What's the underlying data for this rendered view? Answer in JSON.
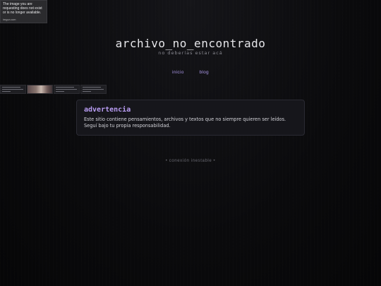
{
  "broken_image": {
    "message": "The image you are\nrequesting does not exist\nor is no longer available.",
    "footer": "imgur.com"
  },
  "header": {
    "title": "archivo_no_encontrado",
    "subtitle": "no deberías estar acá"
  },
  "nav": {
    "items": [
      {
        "label": "inicio"
      },
      {
        "label": "blog"
      }
    ]
  },
  "warning": {
    "title": "advertencia",
    "text": "Este sitio contiene pensamientos, archivos y textos que no siempre quieren ser leídos. Seguí bajo tu propia responsabilidad."
  },
  "footer": {
    "status": "• conexión inestable •"
  }
}
